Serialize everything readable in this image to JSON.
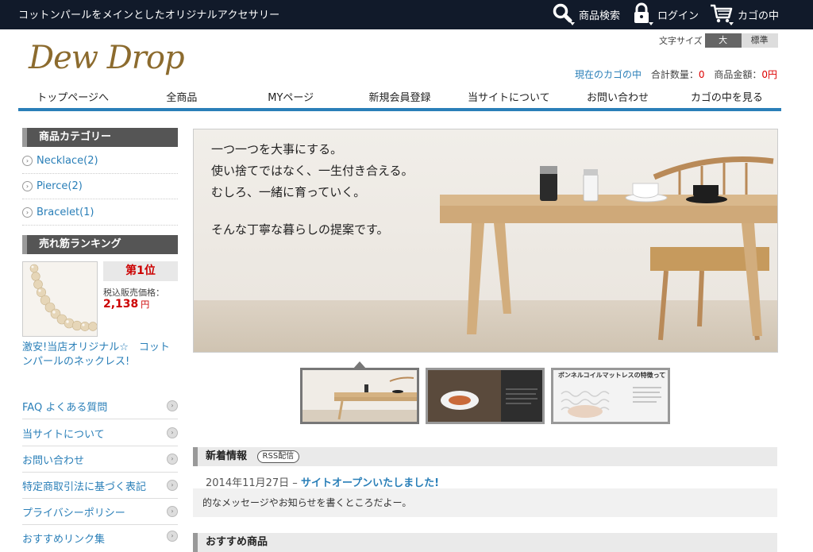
{
  "header": {
    "tagline": "コットンパールをメインとしたオリジナルアクセサリー",
    "search_label": "商品検索",
    "login_label": "ログイン",
    "cart_label": "カゴの中",
    "logo_text": "Dew Drop",
    "font_size_label": "文字サイズ",
    "font_size_large": "大",
    "font_size_standard": "標準",
    "cart_now_label": "現在のカゴの中",
    "total_qty_label": "合計数量：",
    "total_qty_value": "0",
    "total_price_label": "商品金額：",
    "total_price_value": "0円"
  },
  "nav": {
    "items": [
      "トップページへ",
      "全商品",
      "MYページ",
      "新規会員登録",
      "当サイトについて",
      "お問い合わせ",
      "カゴの中を見る"
    ]
  },
  "sidebar": {
    "category_title": "商品カテゴリー",
    "categories": [
      "Necklace(2)",
      "Pierce(2)",
      "Bracelet(1)"
    ],
    "ranking_title": "売れ筋ランキング",
    "ranking": {
      "rank_label": "第1位",
      "price_label": "税込販売価格：",
      "price_value": "2,138",
      "price_unit": "円",
      "product_title": "激安!当店オリジナル☆　コットンパールのネックレス!"
    },
    "links": [
      "FAQ よくある質問",
      "当サイトについて",
      "お問い合わせ",
      "特定商取引法に基づく表記",
      "プライバシーポリシー",
      "おすすめリンク集"
    ]
  },
  "banner": {
    "lines": [
      "一つ一つを大事にする。",
      "使い捨てではなく、一生付き合える。",
      "むしろ、一緒に育っていく。",
      "そんな丁寧な暮らしの提案です。"
    ],
    "thumb3_caption": "ボンネルコイルマットレスの特徴って?"
  },
  "news": {
    "title": "新着情報",
    "rss_label": "RSS配信",
    "date": "2014年11月27日 –",
    "headline": "サイトオープンいたしました!",
    "body": "的なメッセージやお知らせを書くところだよー。"
  },
  "recommend": {
    "title": "おすすめ商品"
  },
  "colors": {
    "topbar": "#111a2a",
    "accent_blue": "#2a7fb8",
    "price_red": "#cc0000",
    "logo_gold": "#8c6b2e"
  }
}
